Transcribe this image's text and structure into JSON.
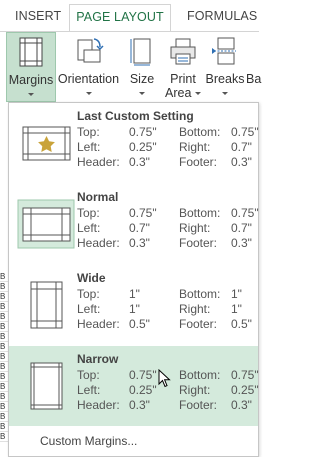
{
  "tabs": [
    {
      "label": "INSERT"
    },
    {
      "label": "PAGE LAYOUT"
    },
    {
      "label": "FORMULAS"
    }
  ],
  "ribbon": {
    "margins": "Margins",
    "orientation": "Orientation",
    "size": "Size",
    "print": "Print",
    "area": "Area",
    "breaks": "Breaks",
    "bg": "Ba"
  },
  "options": [
    {
      "title": "Last Custom Setting",
      "top": "0.75\"",
      "bottom": "0.75\"",
      "left": "0.25\"",
      "right": "0.7\"",
      "header": "0.3\"",
      "footer": "0.3\""
    },
    {
      "title": "Normal",
      "top": "0.75\"",
      "bottom": "0.75\"",
      "left": "0.7\"",
      "right": "0.7\"",
      "header": "0.3\"",
      "footer": "0.3\""
    },
    {
      "title": "Wide",
      "top": "1\"",
      "bottom": "1\"",
      "left": "1\"",
      "right": "1\"",
      "header": "0.5\"",
      "footer": "0.5\""
    },
    {
      "title": "Narrow",
      "top": "0.75\"",
      "bottom": "0.75\"",
      "left": "0.25\"",
      "right": "0.25\"",
      "header": "0.3\"",
      "footer": "0.3\""
    }
  ],
  "labels": {
    "top": "Top:",
    "bottom": "Bottom:",
    "left": "Left:",
    "right": "Right:",
    "header": "Header:",
    "footer": "Footer:"
  },
  "custom_margins": "Custom Margins...",
  "row_letters": [
    "B",
    "B",
    "B",
    "B",
    "B",
    "B",
    "B",
    "B",
    "B",
    "B",
    "B",
    "B",
    "B",
    "B",
    "B",
    "B",
    "B"
  ],
  "colors": {
    "accent": "#217346",
    "selected": "#d4eadc",
    "star": "#c9a33a"
  }
}
